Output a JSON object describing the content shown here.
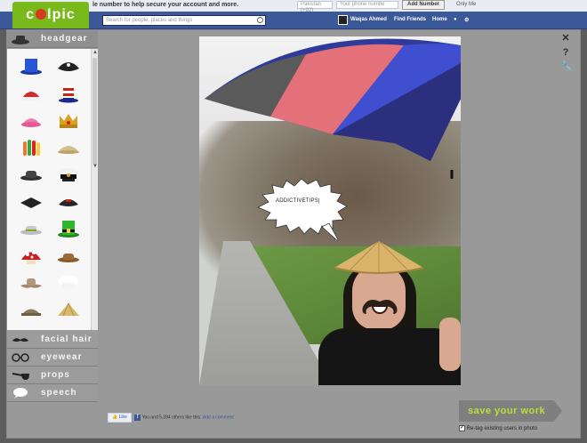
{
  "fb": {
    "notice": "le number to help secure your account and more.",
    "field1": "Pakistan (+92)",
    "field2": "Your phone numbe",
    "add_button": "Add Number",
    "only_me": "Only Me",
    "search_placeholder": "Search for people, places and things",
    "nav_user": "Waqas Ahmed",
    "nav_find": "Find Friends",
    "nav_home": "Home"
  },
  "app": {
    "logo_text": "c lpic"
  },
  "sidebar": {
    "categories": [
      {
        "label": "headgear",
        "icon": "hat-icon"
      },
      {
        "label": "facial hair",
        "icon": "mustache-icon"
      },
      {
        "label": "eyewear",
        "icon": "glasses-icon"
      },
      {
        "label": "props",
        "icon": "pipe-icon"
      },
      {
        "label": "speech",
        "icon": "speech-bubble-icon"
      }
    ]
  },
  "tools": {
    "close": "✕",
    "help": "?",
    "settings": "⚙"
  },
  "photo": {
    "bubble_text": "ADDICTIVETIPS|"
  },
  "likebar": {
    "like_button": "Like",
    "text": "You and 5,394 others like this.",
    "comment_link": "Add a comment"
  },
  "save": {
    "label": "save your work"
  },
  "retag": {
    "label": "Re-tag existing users in photo",
    "checked": "✓"
  },
  "colors": {
    "accent": "#78b91b",
    "save_text": "#b7e233",
    "fb_blue": "#3b5998"
  }
}
